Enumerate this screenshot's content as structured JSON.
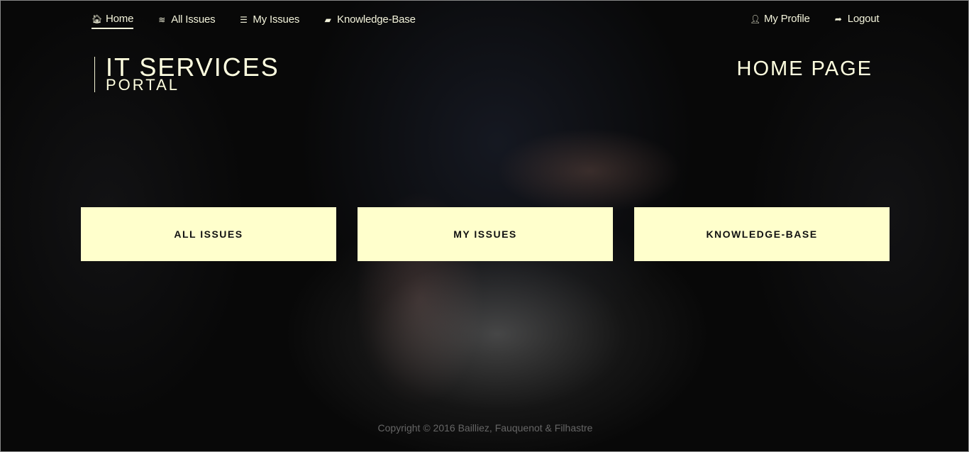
{
  "nav": {
    "left": [
      {
        "label": "Home",
        "icon": "home-icon",
        "glyph": "🏠︎"
      },
      {
        "label": "All Issues",
        "icon": "database-icon",
        "glyph": "≋"
      },
      {
        "label": "My Issues",
        "icon": "list-icon",
        "glyph": "☰"
      },
      {
        "label": "Knowledge-Base",
        "icon": "book-icon",
        "glyph": "▰"
      }
    ],
    "right": [
      {
        "label": "My Profile",
        "icon": "user-icon",
        "glyph": "👤︎"
      },
      {
        "label": "Logout",
        "icon": "logout-icon",
        "glyph": "➦"
      }
    ]
  },
  "brand": {
    "line1": "IT SERVICES",
    "line2": "PORTAL"
  },
  "page_title": "HOME PAGE",
  "tiles": [
    "ALL ISSUES",
    "MY ISSUES",
    "KNOWLEDGE-BASE"
  ],
  "footer": "Copyright © 2016 Bailliez, Fauquenot & Filhastre",
  "colors": {
    "accent": "#ffffcc",
    "text": "#f2f2da"
  }
}
